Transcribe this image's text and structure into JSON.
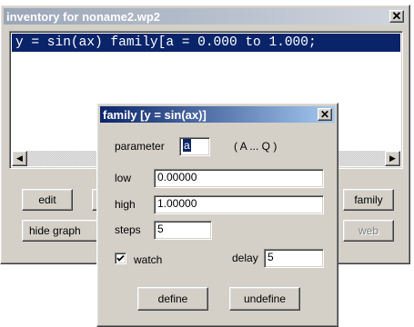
{
  "main": {
    "title": "inventory for noname2.wp2",
    "close_glyph": "✕",
    "list_items": [
      "y = sin(ax) family[a = 0.000 to 1.000;"
    ],
    "scroll_left": "◀",
    "scroll_right": "▶",
    "buttons": {
      "edit": "edit",
      "hide_graph": "hide graph",
      "family": "family",
      "web": "web"
    },
    "web_enabled": false
  },
  "dialog": {
    "title": "family [y = sin(ax)]",
    "close_glyph": "✕",
    "parameter_label": "parameter",
    "parameter_value": "a",
    "parameter_range": "( A ... Q )",
    "low_label": "low",
    "low_value": "0.00000",
    "high_label": "high",
    "high_value": "1.00000",
    "steps_label": "steps",
    "steps_value": "5",
    "watch_label": "watch",
    "watch_checked": true,
    "delay_label": "delay",
    "delay_value": "5",
    "define_label": "define",
    "undefine_label": "undefine"
  },
  "colors": {
    "selection": "#0a246a",
    "dialog_title_start": "#0a246a",
    "dialog_title_end": "#a6caf0",
    "inactive_title_start": "#9aa6b8",
    "face": "#d4d0c8"
  },
  "icons": {
    "close": "close-icon",
    "scroll_left": "arrow-left-icon",
    "scroll_right": "arrow-right-icon",
    "checkbox": "checkmark-icon"
  }
}
